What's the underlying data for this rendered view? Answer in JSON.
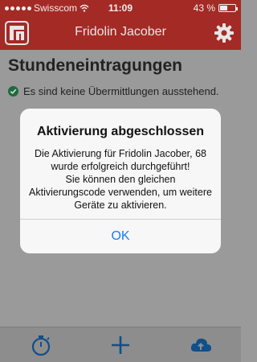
{
  "status_bar": {
    "carrier": "Swisscom",
    "time": "11:09",
    "battery": "43 %",
    "battery_level": 0.43
  },
  "nav": {
    "title": "Fridolin Jacober",
    "logo_icon": "app-logo-icon",
    "settings_icon": "gear-icon"
  },
  "main": {
    "title": "Stundeneintragungen",
    "status_text": "Es sind keine Übermittlungen ausstehend."
  },
  "tabbar": {
    "items": [
      {
        "icon": "stopwatch-icon"
      },
      {
        "icon": "plus-icon"
      },
      {
        "icon": "cloud-upload-icon"
      }
    ]
  },
  "dialog": {
    "title": "Aktivierung abgeschlossen",
    "message": "Die Aktivierung für Fridolin Jacober, 68 wurde erfolgreich durchgeführt!\nSie können den gleichen Aktivierungscode verwenden, um weitere Geräte zu aktivieren.",
    "ok_label": "OK"
  },
  "colors": {
    "brand_red": "#a42a25",
    "check_green": "#1e8f4a",
    "link_blue": "#1a7cf5"
  }
}
